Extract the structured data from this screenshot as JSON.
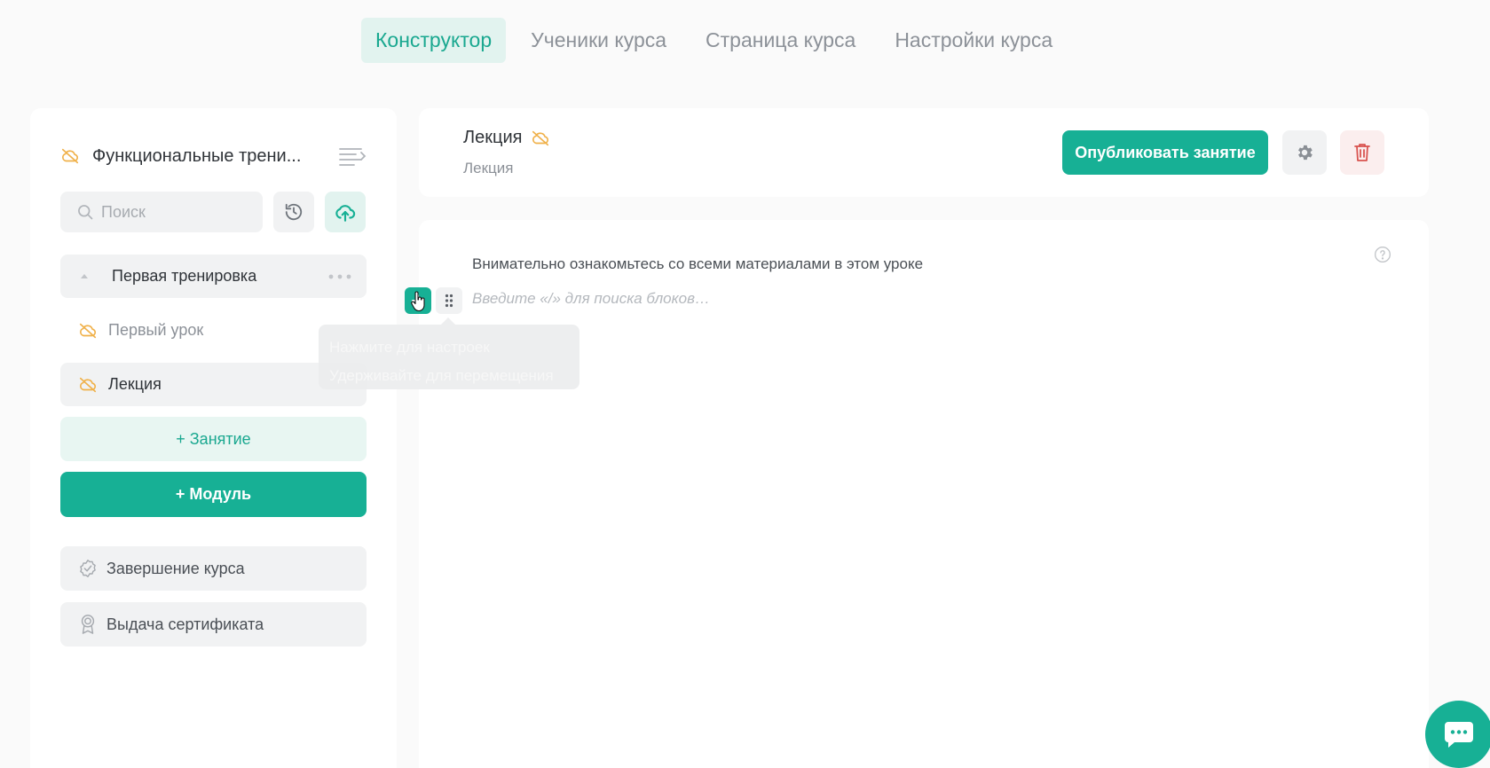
{
  "tabs": [
    {
      "label": "Конструктор",
      "active": true
    },
    {
      "label": "Ученики курса"
    },
    {
      "label": "Страница курса"
    },
    {
      "label": "Настройки курса"
    }
  ],
  "sidebar": {
    "course_title": "Функциональные трени...",
    "search_placeholder": "Поиск",
    "module": {
      "label": "Первая тренировка"
    },
    "lessons": [
      {
        "label": "Первый урок"
      },
      {
        "label": "Лекция"
      }
    ],
    "add_lesson_label": "+ Занятие",
    "add_module_label": "+ Модуль",
    "course_completion_label": "Завершение курса",
    "certificate_label": "Выдача сертификата"
  },
  "header": {
    "lesson_title": "Лекция",
    "lesson_subtitle": "Лекция",
    "publish_label": "Опубликовать занятие"
  },
  "editor": {
    "intro_text": "Внимательно ознакомьтесь со всеми материалами в этом уроке",
    "placeholder": "Введите «/» для поиска блоков…",
    "tooltip_line1": "Нажмите для настроек",
    "tooltip_line2": "Удерживайте для перемещения"
  },
  "colors": {
    "accent": "#17b095",
    "accent_light": "#e2f3ef",
    "hidden_icon": "#f0b14a",
    "danger": "#d9534f"
  },
  "icons": {
    "hidden": "eye-off-cloud-icon",
    "toc": "list-indent-icon",
    "search": "search-icon",
    "history": "history-icon",
    "upload": "cloud-upload-icon",
    "collapse": "chevron-up-icon",
    "more": "more-horizontal-icon",
    "completion": "badge-check-icon",
    "certificate": "award-icon",
    "settings": "gear-icon",
    "delete": "trash-icon",
    "help": "question-circle-icon",
    "add": "plus-icon",
    "drag": "drag-handle-icon",
    "chat": "chat-bubble-icon"
  }
}
